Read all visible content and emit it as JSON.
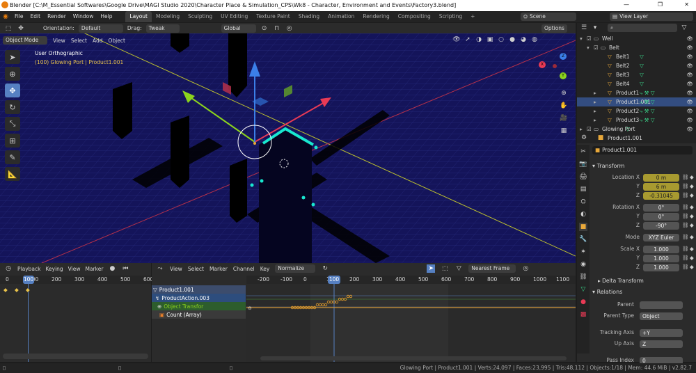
{
  "window": {
    "title": "Blender [C:\\M_Essential Softwares\\Google Drive\\MAGI Studio 2020\\Character Place & Simulation_CPS\\Wk8 - Character, Environment and Events\\Factory3.blend]",
    "controls": [
      "—",
      "❐",
      "✕"
    ]
  },
  "menu": {
    "items": [
      "File",
      "Edit",
      "Render",
      "Window",
      "Help"
    ],
    "tabs": [
      "Layout",
      "Modeling",
      "Sculpting",
      "UV Editing",
      "Texture Paint",
      "Shading",
      "Animation",
      "Rendering",
      "Compositing",
      "Scripting"
    ],
    "add_tab": "+",
    "scene": "Scene",
    "view_layer": "View Layer"
  },
  "toolhdr": {
    "orientation_label": "Orientation:",
    "orientation": "Default",
    "drag_label": "Drag:",
    "drag": "Tweak",
    "transform": "Global",
    "options": "Options"
  },
  "viewport": {
    "mode": "Object Mode",
    "menus": [
      "View",
      "Select",
      "Add",
      "Object"
    ],
    "view_name": "User Orthographic",
    "selection": "(100) Glowing Port | Product1.001",
    "gizmo": {
      "x": "X",
      "y": "Y",
      "z": "Z"
    }
  },
  "outliner": {
    "search_placeholder": "",
    "items": [
      {
        "name": "Well",
        "kind": "collection",
        "indent": 1,
        "expand": "▾"
      },
      {
        "name": "Belt",
        "kind": "collection",
        "indent": 2,
        "expand": "▾"
      },
      {
        "name": "Belt1",
        "kind": "mesh",
        "indent": 3,
        "mods": "▽"
      },
      {
        "name": "Belt2",
        "kind": "mesh",
        "indent": 3,
        "mods": "▽"
      },
      {
        "name": "Belt3",
        "kind": "mesh",
        "indent": 3,
        "mods": "▽"
      },
      {
        "name": "Belt4",
        "kind": "mesh",
        "indent": 3,
        "mods": "▽"
      },
      {
        "name": "Product1",
        "kind": "mesh",
        "indent": 3,
        "expand": "▸",
        "mods": "⤷ ⚒ ▽"
      },
      {
        "name": "Product1.001",
        "kind": "mesh",
        "indent": 3,
        "expand": "▸",
        "mods": "⤷ ⚒ ▽",
        "selected": true
      },
      {
        "name": "Product2",
        "kind": "mesh",
        "indent": 3,
        "expand": "▸",
        "mods": "⤷ ⚒ ▽"
      },
      {
        "name": "Product3",
        "kind": "mesh",
        "indent": 3,
        "expand": "▸",
        "mods": "⤷ ⚒ ▽"
      },
      {
        "name": "Glowing Port",
        "kind": "collection",
        "indent": 1,
        "expand": "▸",
        "mods": "▽"
      }
    ]
  },
  "properties": {
    "object_name": "Product1.001",
    "data_name": "Product1.001",
    "transform_title": "Transform",
    "location": {
      "label": "Location X",
      "y_label": "Y",
      "z_label": "Z",
      "x": "0 m",
      "y": "6 m",
      "z": "-0.31045"
    },
    "rotation": {
      "label": "Rotation X",
      "y_label": "Y",
      "z_label": "Z",
      "x": "0°",
      "y": "0°",
      "z": "-90°"
    },
    "mode": {
      "label": "Mode",
      "value": "XYZ Euler"
    },
    "scale": {
      "label": "Scale X",
      "y_label": "Y",
      "z_label": "Z",
      "x": "1.000",
      "y": "1.000",
      "z": "1.000"
    },
    "delta_title": "Delta Transform",
    "relations_title": "Relations",
    "parent": {
      "label": "Parent",
      "value": ""
    },
    "parent_type": {
      "label": "Parent Type",
      "value": "Object"
    },
    "tracking_axis": {
      "label": "Tracking Axis",
      "value": "+Y"
    },
    "up_axis": {
      "label": "Up Axis",
      "value": "Z"
    },
    "pass_index": {
      "label": "Pass Index",
      "value": "0"
    }
  },
  "timeline": {
    "menus": [
      "Playback",
      "Keying",
      "View",
      "Marker"
    ],
    "current_frame": "100",
    "ticks": [
      "0",
      "100",
      "200",
      "300",
      "400",
      "500",
      "600"
    ]
  },
  "graph": {
    "menus": [
      "View",
      "Select",
      "Marker",
      "Channel",
      "Key"
    ],
    "normalize": "Normalize",
    "interpolation": "Nearest Frame",
    "current_frame": "100",
    "ticks": [
      "-200",
      "-100",
      "0",
      "100",
      "200",
      "300",
      "400",
      "500",
      "600",
      "700",
      "800",
      "900",
      "1000",
      "1100"
    ],
    "channels": [
      {
        "name": "Product1.001",
        "kind": "object"
      },
      {
        "name": "ProductAction.003",
        "kind": "action"
      },
      {
        "name": "Object Transfor",
        "kind": "group"
      },
      {
        "name": "Count (Array)",
        "kind": "fcurve"
      }
    ],
    "curve_points": "0 0 0 0 0 0 0 0 0 1 1 1 1 2 2 2 2 3 3 3 4 4"
  },
  "status": {
    "text": "Glowing Port | Product1.001 | Verts:24,097 | Faces:23,995 | Tris:48,112 | Objects:1/18 | Mem: 44.6 MiB | v2.82.7"
  },
  "colors": {
    "accent": "#5680c2",
    "viewport_bg": "#14145a",
    "x_axis": "#e83a55",
    "y_axis": "#8bd31d",
    "z_axis": "#3b7fe8",
    "glow": "#18e8d0",
    "keyframe": "#e89f2a"
  }
}
